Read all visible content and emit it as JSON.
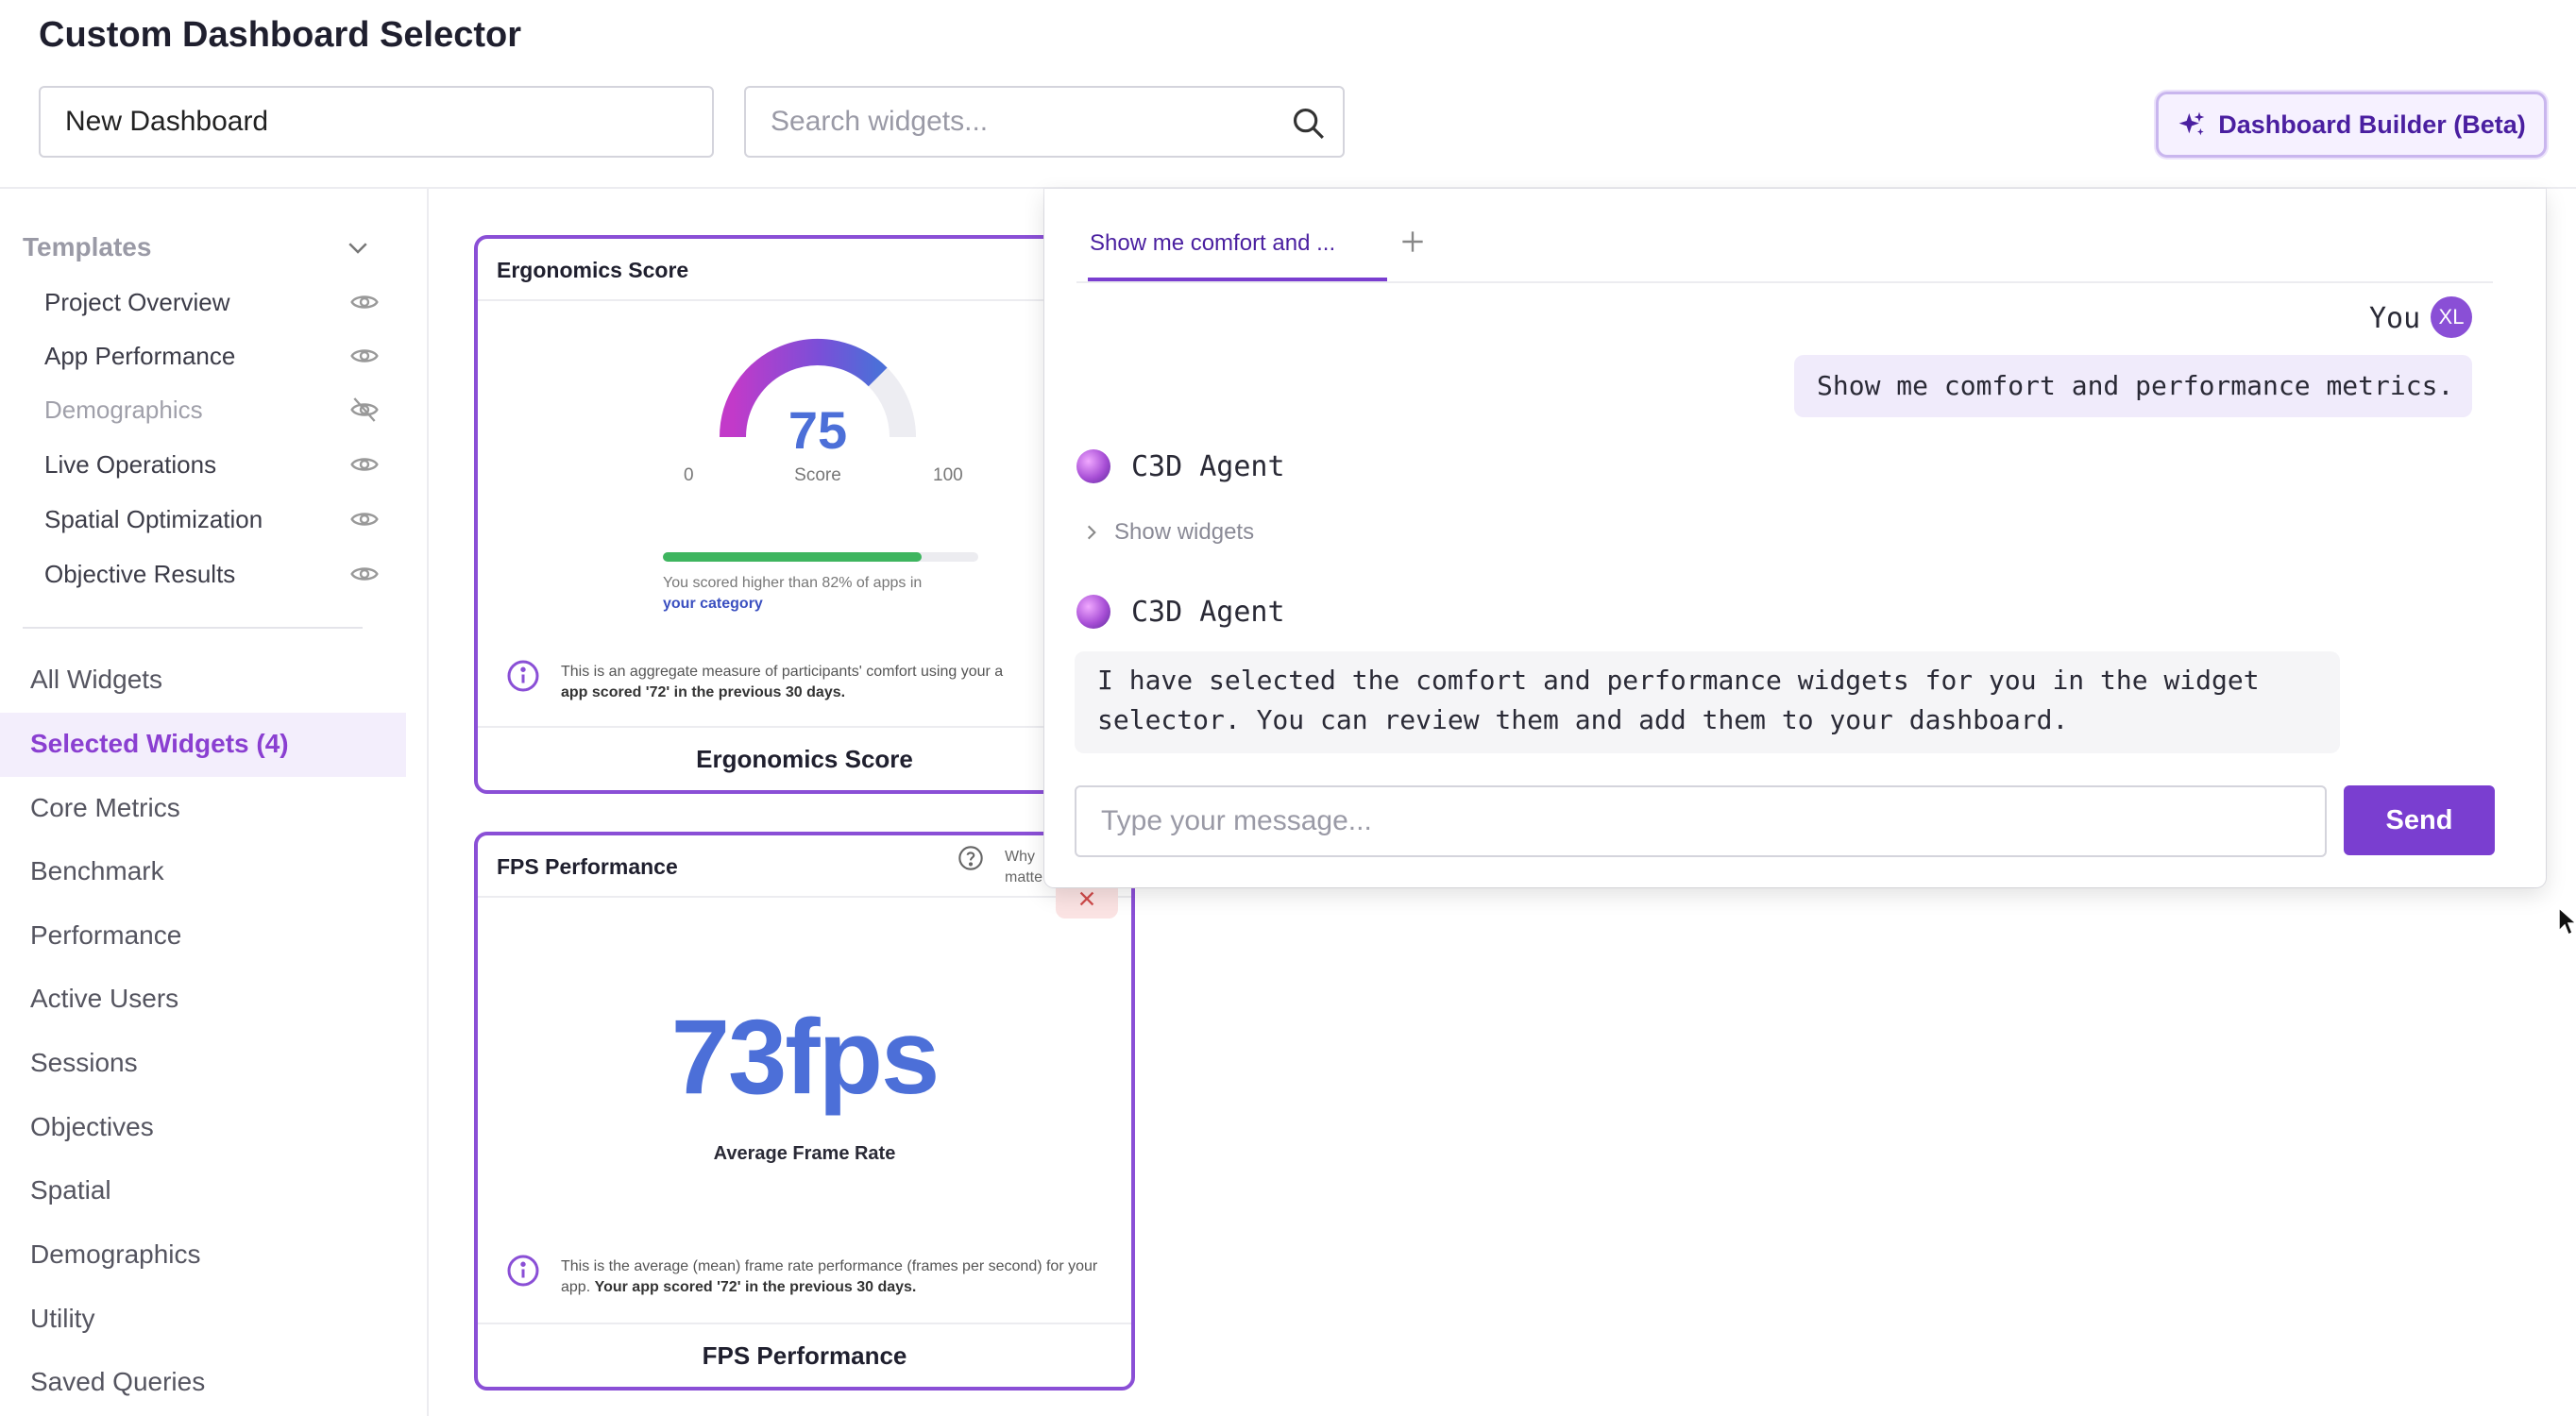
{
  "app": {
    "title": "Custom Dashboard Selector"
  },
  "toolbar": {
    "dashboard_name": "New Dashboard",
    "search_placeholder": "Search widgets...",
    "builder_label": "Dashboard Builder (Beta)"
  },
  "sidebar": {
    "templates_label": "Templates",
    "templates": [
      {
        "label": "Project Overview",
        "visible": true
      },
      {
        "label": "App Performance",
        "visible": true
      },
      {
        "label": "Demographics",
        "visible": false
      },
      {
        "label": "Live Operations",
        "visible": true
      },
      {
        "label": "Spatial Optimization",
        "visible": true
      },
      {
        "label": "Objective Results",
        "visible": true
      }
    ],
    "nav": [
      "All Widgets",
      "Selected Widgets (4)",
      "Core Metrics",
      "Benchmark",
      "Performance",
      "Active Users",
      "Sessions",
      "Objectives",
      "Spatial",
      "Demographics",
      "Utility",
      "Saved Queries"
    ],
    "selected_index": 1
  },
  "widgets": {
    "ergonomics": {
      "title": "Ergonomics Score",
      "value": "75",
      "score": 75,
      "min": "0",
      "max": "100",
      "gauge_label": "Score",
      "progress_fraction": 0.82,
      "progress_text": "You scored higher than 82% of apps in",
      "progress_link": "your category",
      "info_text": "This is an aggregate measure of participants' comfort using your a",
      "info_bold": "app scored '72' in the previous 30 days.",
      "footer": "Ergonomics Score"
    },
    "fps": {
      "title": "FPS Performance",
      "why_text": "Why matte",
      "value": "73fps",
      "subtitle": "Average Frame Rate",
      "info_text": "This is the average (mean) frame rate performance (frames per second) for your app.",
      "info_bold": "Your app scored '72' in the previous 30 days.",
      "footer": "FPS Performance"
    }
  },
  "chat": {
    "tab_label": "Show me comfort and ...",
    "you_label": "You",
    "avatar_initials": "XL",
    "user_message": "Show me comfort and performance metrics.",
    "agent_name": "C3D Agent",
    "show_widgets": "Show widgets",
    "agent_message": "I have selected the comfort and performance widgets for you in the widget selector. You can review them and add them to your dashboard.",
    "input_placeholder": "Type your message...",
    "send_label": "Send"
  },
  "colors": {
    "accent": "#7a3ed0",
    "card_border": "#8a4fd6",
    "metric_blue": "#4c6fd8",
    "progress_green": "#3eb55f"
  }
}
